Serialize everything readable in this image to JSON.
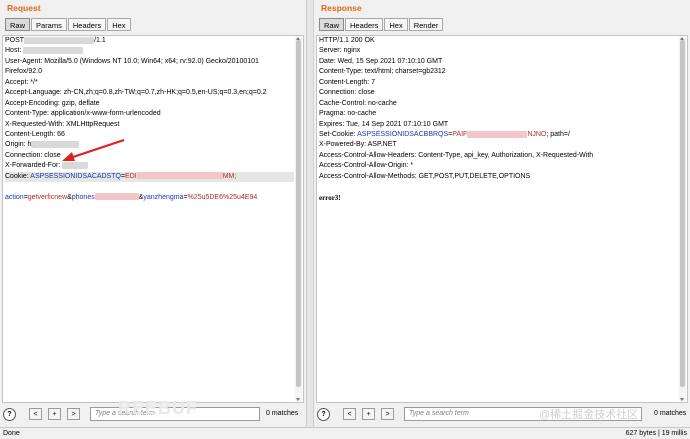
{
  "request": {
    "title": "Request",
    "tabs": [
      "Raw",
      "Params",
      "Headers",
      "Hex"
    ],
    "lines": [
      {
        "a": "POST",
        "b": "/1.1"
      },
      {
        "a": "Host:"
      },
      {
        "a": "User-Agent: Mozilla/5.0 (Windows NT 10.0; Win64; x64; rv:92.0) Gecko/20100101"
      },
      {
        "a": "Firefox/92.0"
      },
      {
        "a": "Accept: */*"
      },
      {
        "a": "Accept-Language: zh-CN,zh;q=0.8,zh-TW;q=0.7,zh-HK;q=0.5,en-US;q=0.3,en;q=0.2"
      },
      {
        "a": "Accept-Encoding: gzip, deflate"
      },
      {
        "a": "Content-Type: application/x-www-form-urlencoded"
      },
      {
        "a": "X-Requested-With: XMLHttpRequest"
      },
      {
        "a": "Content-Length: 66"
      },
      {
        "a": "Origin: h"
      },
      {
        "a": "Connection: close"
      },
      {
        "a": "X-Forwarded-For:"
      },
      {
        "a": "Cookie: ",
        "k": "ASPSESSIONIDSACADSTQ",
        "eq": "=",
        "v": "EDI",
        "tail": "MM;"
      },
      {
        "a": ""
      },
      {
        "k": "action",
        "eq": "=",
        "v": "getverficnew",
        "amp": "&",
        "k2": "phones",
        "amp2": "&",
        "k3": "yanzhengma",
        "eq2": "=",
        "v3": "%25u5DE6%25u4E94"
      }
    ],
    "search": {
      "placeholder": "Type a search term",
      "matches": "0 matches",
      "btn_prev": "<",
      "btn_add": "+",
      "btn_next": ">",
      "help": "?"
    }
  },
  "response": {
    "title": "Response",
    "tabs": [
      "Raw",
      "Headers",
      "Hex",
      "Render"
    ],
    "lines": [
      {
        "a": "HTTP/1.1 200 OK"
      },
      {
        "a": "Server: nginx"
      },
      {
        "a": "Date: Wed, 15 Sep 2021 07:10:10 GMT"
      },
      {
        "a": "Content-Type: text/html; charset=gb2312"
      },
      {
        "a": "Content-Length: 7"
      },
      {
        "a": "Connection: close"
      },
      {
        "a": "Cache-Control: no-cache"
      },
      {
        "a": "Pragma: no-cache"
      },
      {
        "a": "Expires: Tue, 14 Sep 2021 07:10:10 GMT"
      },
      {
        "a": "Set-Cookie: ",
        "k": "ASPSESSIONIDSACBBRQS",
        "eq": "=",
        "v": "PAIF",
        "v2": "NJNO",
        "tail": "; path=/"
      },
      {
        "a": "X-Powered-By: ASP.NET"
      },
      {
        "a": "Access-Control-Allow-Headers: Content-Type, api_key, Authorization, X-Requested-With"
      },
      {
        "a": "Access-Control-Allow-Origin: *"
      },
      {
        "a": "Access-Control-Allow-Methods: GET,POST,PUT,DELETE,OPTIONS"
      },
      {
        "a": ""
      },
      {
        "a": "error3!"
      }
    ],
    "search": {
      "placeholder": "Type a search term",
      "matches": "0 matches",
      "btn_prev": "<",
      "btn_add": "+",
      "btn_next": ">",
      "help": "?"
    }
  },
  "status": {
    "left": "Done",
    "right": "627 bytes | 19 millis"
  },
  "watermark": {
    "left": "REEBUF",
    "right": "@稀土掘金技术社区"
  },
  "colors": {
    "title": "#e2661a",
    "key": "#2232b5",
    "value": "#b22a2a",
    "arrow": "#e02020"
  }
}
